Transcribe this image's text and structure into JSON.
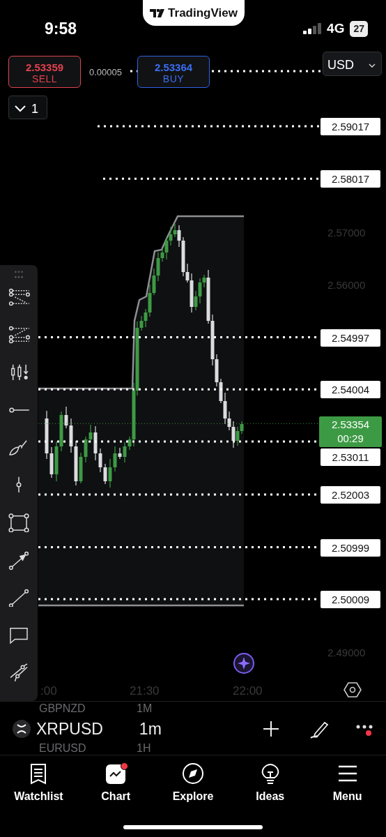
{
  "status_bar": {
    "time": "9:58",
    "network": "4G",
    "battery": "27"
  },
  "app_banner": {
    "title": "TradingView"
  },
  "trade": {
    "sell": {
      "price": "2.53359",
      "label": "SELL"
    },
    "spread": "0.00005",
    "buy": {
      "price": "2.53364",
      "label": "BUY"
    }
  },
  "currency": {
    "value": "USD"
  },
  "orders_toggle": {
    "count": "1",
    "expanded": false
  },
  "price_axis": [
    {
      "kind": "line",
      "price": "2.59017"
    },
    {
      "kind": "line",
      "price": "2.58017"
    },
    {
      "kind": "tick",
      "price": "2.57000"
    },
    {
      "kind": "tick",
      "price": "2.56000"
    },
    {
      "kind": "line",
      "price": "2.54997"
    },
    {
      "kind": "line",
      "price": "2.54004"
    },
    {
      "kind": "current",
      "price": "2.53354",
      "timer": "00:29"
    },
    {
      "kind": "line",
      "price": "2.53011"
    },
    {
      "kind": "line",
      "price": "2.52003"
    },
    {
      "kind": "line",
      "price": "2.50999"
    },
    {
      "kind": "line",
      "price": "2.50009"
    },
    {
      "kind": "tick",
      "price": "2.49000"
    }
  ],
  "time_axis": [
    ":00",
    "21:30",
    "22:00"
  ],
  "symbol_bar": {
    "above": {
      "symbol": "GBPNZD",
      "interval": "1M"
    },
    "symbol": "XRPUSD",
    "interval": "1m",
    "below": {
      "symbol": "EURUSD",
      "interval": "1H"
    },
    "more_badge": true
  },
  "nav": [
    {
      "kind": "watchlist",
      "label": "Watchlist",
      "selected": false,
      "badge": false
    },
    {
      "kind": "chart",
      "label": "Chart",
      "selected": true,
      "badge": true
    },
    {
      "kind": "explore",
      "label": "Explore",
      "selected": false,
      "badge": false
    },
    {
      "kind": "ideas",
      "label": "Ideas",
      "selected": false,
      "badge": false
    },
    {
      "kind": "menu",
      "label": "Menu",
      "selected": false,
      "badge": false
    }
  ]
}
